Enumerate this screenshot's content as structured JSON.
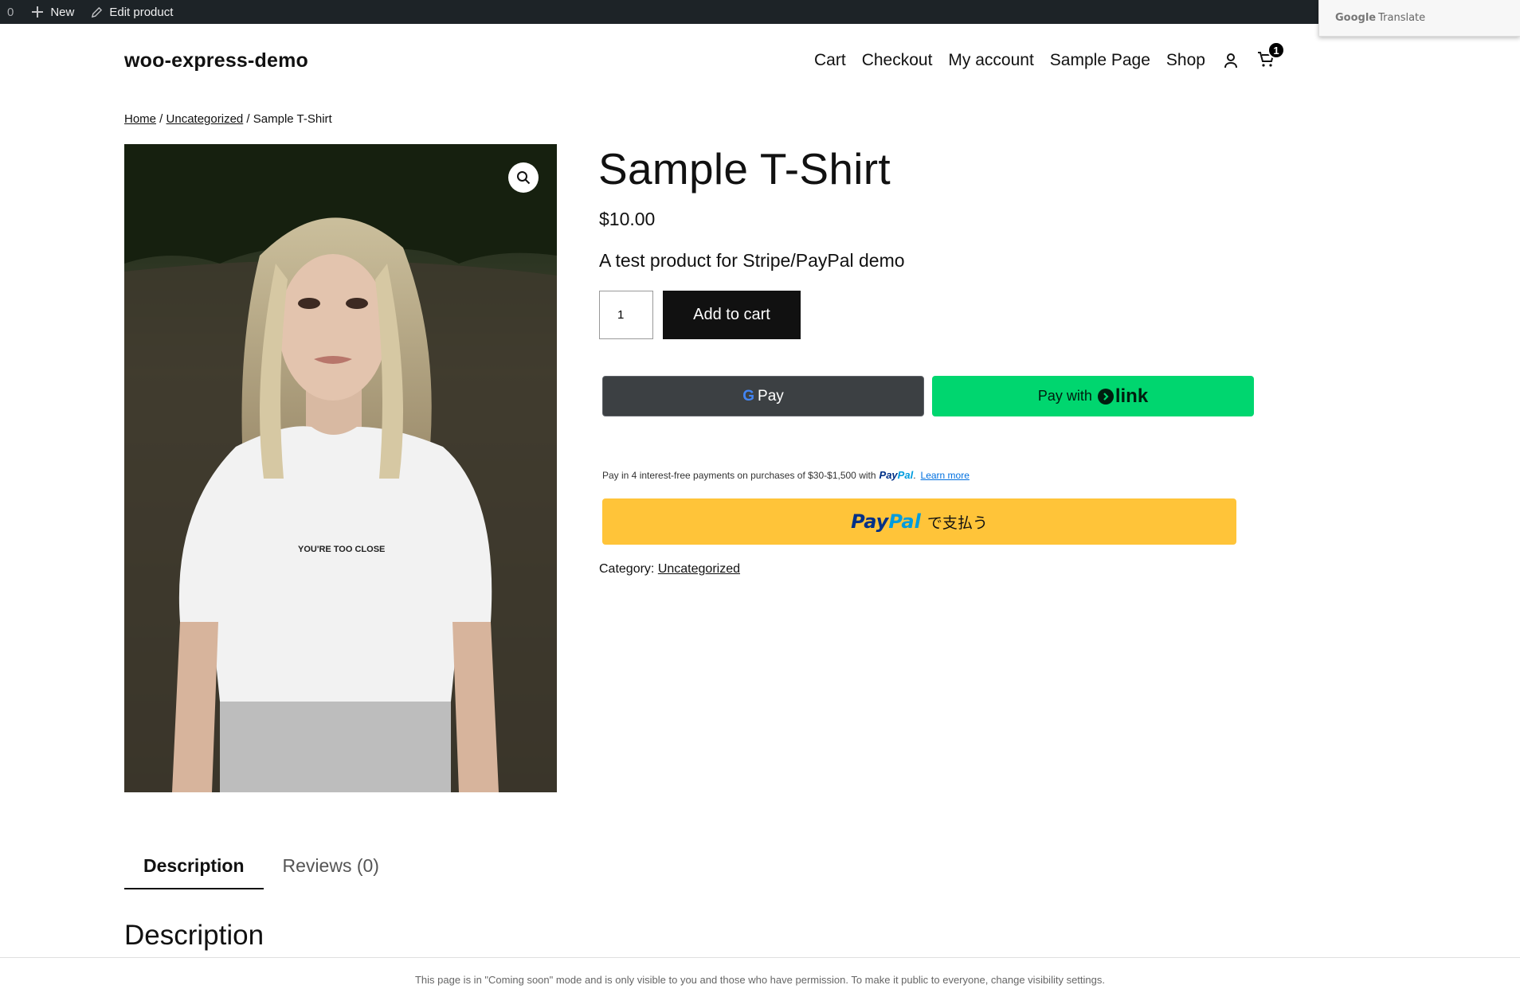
{
  "admin_bar": {
    "comments_count": "0",
    "new_label": "New",
    "edit_label": "Edit product"
  },
  "translate": {
    "brand": "Google",
    "label": "Translate"
  },
  "header": {
    "site_title": "woo-express-demo",
    "nav": [
      "Cart",
      "Checkout",
      "My account",
      "Sample Page",
      "Shop"
    ],
    "cart_count": "1"
  },
  "breadcrumb": {
    "home": "Home",
    "sep": " / ",
    "category": "Uncategorized",
    "current": "Sample T-Shirt"
  },
  "product": {
    "image_alt_shirt_text": "YOU'RE TOO CLOSE",
    "title": "Sample T-Shirt",
    "price": "$10.00",
    "short_description": "A test product for Stripe/PayPal demo",
    "quantity": "1",
    "add_to_cart": "Add to cart",
    "category_label": "Category:",
    "category": "Uncategorized"
  },
  "payments": {
    "gpay_g": "G",
    "gpay_label": "Pay",
    "link_prefix": "Pay with",
    "link_word": "link",
    "paylater_text": "Pay in 4 interest-free payments on purchases of $30-$1,500 with",
    "paypal_a": "Pay",
    "paypal_b": "Pal",
    "learn_more": "Learn more",
    "paypal_button_text": "で支払う"
  },
  "tabs": [
    {
      "label": "Description",
      "active": true
    },
    {
      "label": "Reviews (0)",
      "active": false
    }
  ],
  "description_heading": "Description",
  "notice": "This page is in \"Coming soon\" mode and is only visible to you and those who have permission. To make it public to everyone, change visibility settings.",
  "colors": {
    "admin_bar": "#1d2327",
    "paypal_yellow": "#ffc439",
    "link_green": "#00d66f",
    "gpay_dark": "#3c4043"
  }
}
